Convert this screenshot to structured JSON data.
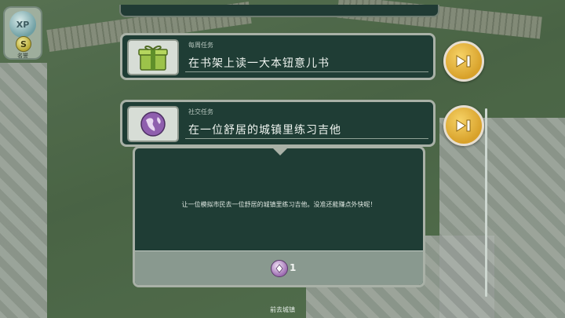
{
  "hud": {
    "xp_label": "XP",
    "coin_symbol": "S",
    "simoleon_label": "名誉"
  },
  "quests": [
    {
      "category": "每周任务",
      "title": "在书架上读一大本钮意儿书",
      "icon": "gift-box-icon",
      "skip_icon": "skip-forward-icon"
    },
    {
      "category": "社交任务",
      "title": "在一位舒居的城镇里练习吉他",
      "icon": "globe-icon",
      "skip_icon": "skip-forward-icon"
    }
  ],
  "detail": {
    "description": "让一位模拟市民去一位舒居的城镇里练习吉他。没准还能赚点外快呢！",
    "reward": {
      "icon": "lifetime-point-icon",
      "count": "1"
    }
  },
  "footer": {
    "label": "前去城镇"
  },
  "colors": {
    "panel_bg": "#1f3d35",
    "panel_border": "#a9b1a7",
    "skip_button": "#e2b43e",
    "reward_strip": "#89998f"
  }
}
